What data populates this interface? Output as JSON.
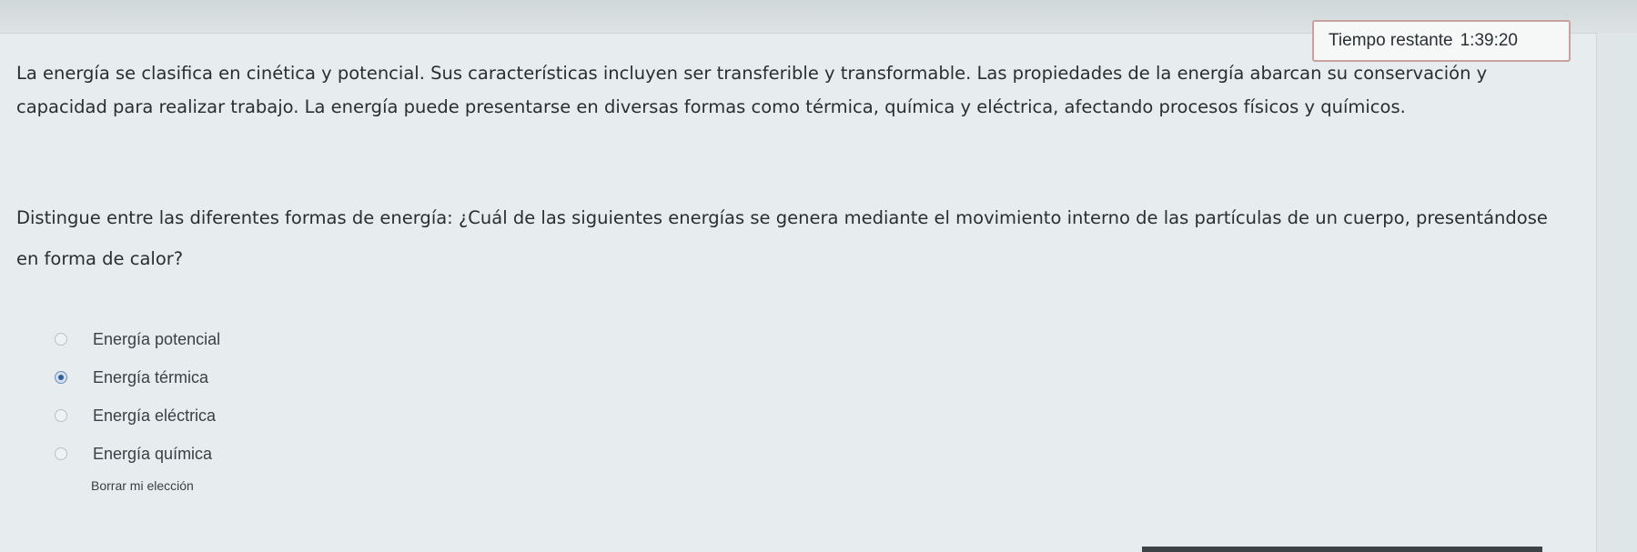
{
  "timer": {
    "label": "Tiempo restante",
    "value": "1:39:20"
  },
  "passage": {
    "text": "La energía se clasifica en cinética y potencial. Sus características incluyen ser transferible y transformable. Las propiedades de la energía abarcan su conservación y capacidad para realizar trabajo. La energía puede presentarse en diversas formas como térmica, química y eléctrica, afectando procesos físicos y químicos."
  },
  "question": {
    "text": "Distingue entre las diferentes formas de energía: ¿Cuál de las siguientes energías se genera mediante el movimiento interno de las partículas de un cuerpo, presentándose en forma de calor?"
  },
  "answers": {
    "options": [
      {
        "label": "Energía potencial",
        "selected": false
      },
      {
        "label": "Energía térmica",
        "selected": true
      },
      {
        "label": "Energía eléctrica",
        "selected": false
      },
      {
        "label": "Energía química",
        "selected": false
      }
    ],
    "clear_label": "Borrar mi elección"
  },
  "colors": {
    "background": "#e7edee",
    "timer_border": "#c9a1a1",
    "selected_radio": "#2e5e9a"
  }
}
